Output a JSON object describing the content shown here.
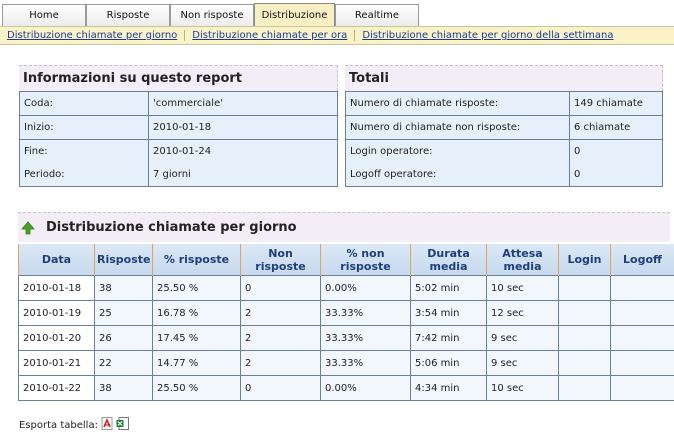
{
  "tabs": [
    "Home",
    "Risposte",
    "Non risposte",
    "Distribuzione",
    "Realtime"
  ],
  "active_tab": "Distribuzione",
  "subnav": [
    "Distribuzione chiamate per giorno",
    "Distribuzione chiamate per ora",
    "Distribuzione chiamate per giorno della settimana"
  ],
  "info": {
    "title": "Informazioni su questo report",
    "rows": [
      {
        "label": "Coda:",
        "value": "'commerciale'"
      },
      {
        "label": "Inizio:",
        "value": "2010-01-18"
      },
      {
        "label": "Fine:",
        "value": "2010-01-24"
      },
      {
        "label": "Periodo:",
        "value": "7 giorni"
      }
    ]
  },
  "totals": {
    "title": "Totali",
    "rows": [
      {
        "label": "Numero di chiamate risposte:",
        "value": "149 chiamate"
      },
      {
        "label": "Numero di chiamate non risposte:",
        "value": "6 chiamate"
      },
      {
        "label": "Login operatore:",
        "value": "0"
      },
      {
        "label": "Logoff operatore:",
        "value": "0"
      }
    ]
  },
  "distribution": {
    "title": "Distribuzione chiamate per giorno",
    "headers": [
      "Data",
      "Risposte",
      "% risposte",
      "Non risposte",
      "% non risposte",
      "Durata media",
      "Attesa media",
      "Login",
      "Logoff"
    ],
    "rows": [
      [
        "2010-01-18",
        "38",
        "25.50 %",
        "0",
        "0.00%",
        "5:02 min",
        "10 sec",
        "",
        ""
      ],
      [
        "2010-01-19",
        "25",
        "16.78 %",
        "2",
        "33.33%",
        "3:54 min",
        "12 sec",
        "",
        ""
      ],
      [
        "2010-01-20",
        "26",
        "17.45 %",
        "2",
        "33.33%",
        "7:42 min",
        "9 sec",
        "",
        ""
      ],
      [
        "2010-01-21",
        "22",
        "14.77 %",
        "2",
        "33.33%",
        "5:06 min",
        "9 sec",
        "",
        ""
      ],
      [
        "2010-01-22",
        "38",
        "25.50 %",
        "0",
        "0.00%",
        "4:34 min",
        "10 sec",
        "",
        ""
      ]
    ]
  },
  "export": {
    "label": "Esporta tabella:",
    "icons": [
      "pdf-icon",
      "excel-icon"
    ]
  }
}
